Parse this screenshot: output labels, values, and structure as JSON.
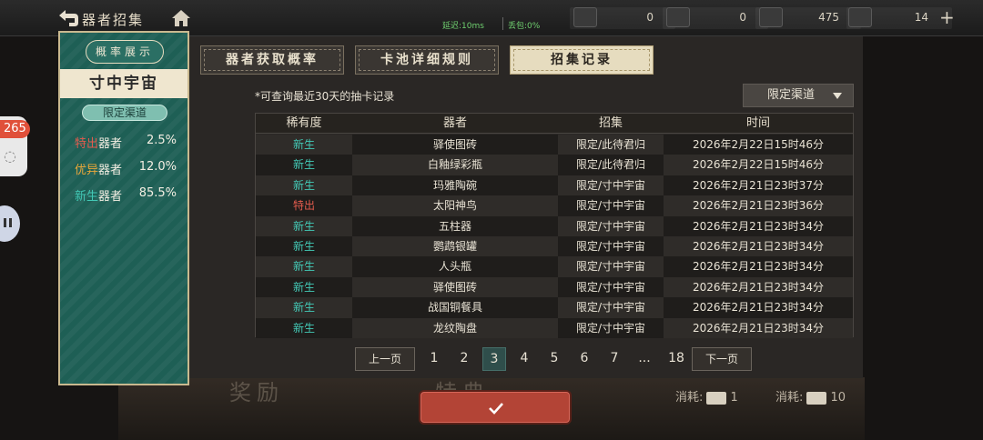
{
  "topbar": {
    "title": "器者招集",
    "net_status": "延迟:10ms",
    "loss_status": "丢包:0%",
    "resources": [
      {
        "icon": "letter-ticket-icon",
        "value": "0"
      },
      {
        "icon": "seal-ticket-icon",
        "value": "0"
      },
      {
        "icon": "gear-ticket-icon",
        "value": "475"
      },
      {
        "icon": "fan-ticket-icon",
        "value": "14"
      }
    ],
    "plus": "+"
  },
  "left_panel": {
    "prob_button": "概率展示",
    "pool_name": "寸中宇宙",
    "channel_tag": "限定渠道",
    "rates": [
      {
        "rarity": "特出",
        "suffix": "器者",
        "pct": "2.5%",
        "color": "#e25b4d"
      },
      {
        "rarity": "优异",
        "suffix": "器者",
        "pct": "12.0%",
        "color": "#e8a73a"
      },
      {
        "rarity": "新生",
        "suffix": "器者",
        "pct": "85.5%",
        "color": "#43c9b6"
      }
    ]
  },
  "side": {
    "badge_count": "265"
  },
  "dialog": {
    "tabs": [
      "器者获取概率",
      "卡池详细规则",
      "招集记录"
    ],
    "active_tab": 2,
    "note": "*可查询最近30天的抽卡记录",
    "channel_select": "限定渠道",
    "table": {
      "headers": [
        "稀有度",
        "器者",
        "招集",
        "时间"
      ],
      "rows": [
        [
          "新生",
          "驿使图砖",
          "限定/此待君归",
          "2026年2月22日15时46分"
        ],
        [
          "新生",
          "白釉绿彩瓶",
          "限定/此待君归",
          "2026年2月22日15时46分"
        ],
        [
          "新生",
          "玛雅陶碗",
          "限定/寸中宇宙",
          "2026年2月21日23时37分"
        ],
        [
          "特出",
          "太阳神鸟",
          "限定/寸中宇宙",
          "2026年2月21日23时36分"
        ],
        [
          "新生",
          "五柱器",
          "限定/寸中宇宙",
          "2026年2月21日23时34分"
        ],
        [
          "新生",
          "鹦鹉银罐",
          "限定/寸中宇宙",
          "2026年2月21日23时34分"
        ],
        [
          "新生",
          "人头瓶",
          "限定/寸中宇宙",
          "2026年2月21日23时34分"
        ],
        [
          "新生",
          "驿使图砖",
          "限定/寸中宇宙",
          "2026年2月21日23时34分"
        ],
        [
          "新生",
          "战国铜餐具",
          "限定/寸中宇宙",
          "2026年2月21日23时34分"
        ],
        [
          "新生",
          "龙纹陶盘",
          "限定/寸中宇宙",
          "2026年2月21日23时34分"
        ]
      ]
    },
    "pagination": {
      "prev": "上一页",
      "next": "下一页",
      "pages": [
        "1",
        "2",
        "3",
        "4",
        "5",
        "6",
        "7",
        "...",
        "18"
      ],
      "current": "3"
    }
  },
  "bottom": {
    "consume_label": "消耗:",
    "consume_values": [
      "1",
      "10"
    ]
  },
  "colors": {
    "new": "#43c9b6",
    "special": "#e25b4d",
    "excellent": "#e8a73a",
    "confirm": "#b34436"
  }
}
